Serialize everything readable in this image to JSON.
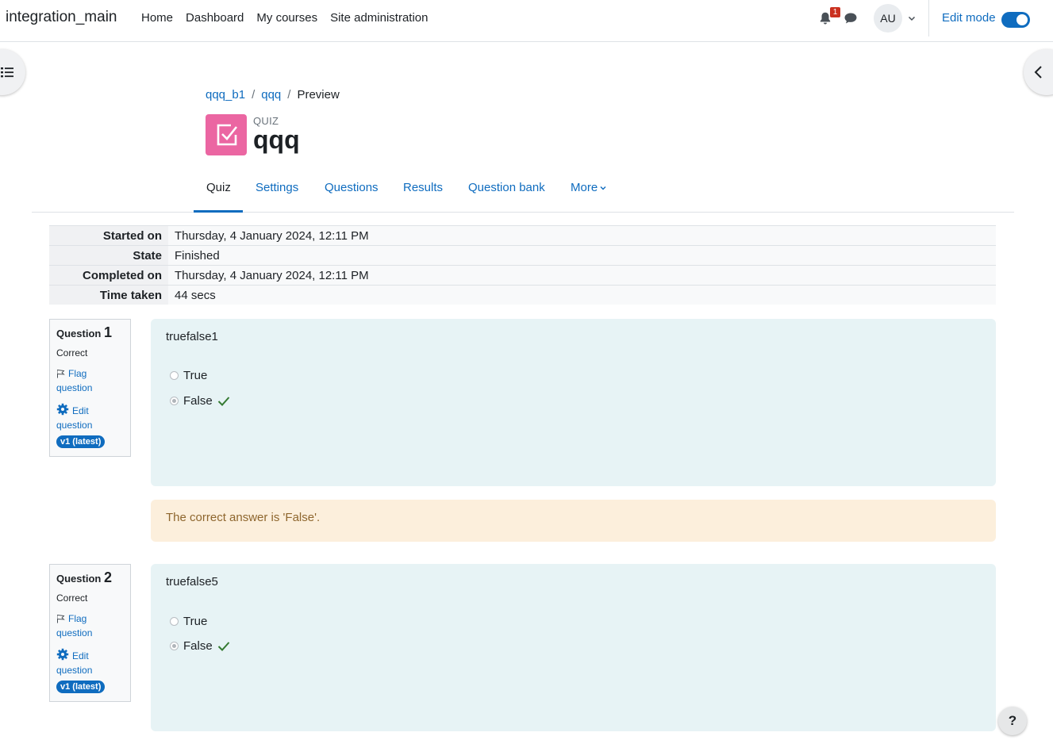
{
  "navbar": {
    "site_name": "integration_main",
    "links": [
      "Home",
      "Dashboard",
      "My courses",
      "Site administration"
    ],
    "notification_count": "1",
    "user_initials": "AU",
    "edit_mode_label": "Edit mode",
    "edit_mode_on": true
  },
  "breadcrumb": {
    "items": [
      "qqq_b1",
      "qqq"
    ],
    "current": "Preview",
    "separator": "/"
  },
  "header": {
    "kicker": "QUIZ",
    "title": "qqq",
    "icon_color": "#eb66a2"
  },
  "tabs": {
    "items": [
      "Quiz",
      "Settings",
      "Questions",
      "Results",
      "Question bank",
      "More"
    ],
    "active": "Quiz"
  },
  "summary": {
    "rows": [
      {
        "label": "Started on",
        "value": "Thursday, 4 January 2024, 12:11 PM"
      },
      {
        "label": "State",
        "value": "Finished"
      },
      {
        "label": "Completed on",
        "value": "Thursday, 4 January 2024, 12:11 PM"
      },
      {
        "label": "Time taken",
        "value": "44 secs"
      }
    ]
  },
  "questions": [
    {
      "label": "Question",
      "number": "1",
      "state": "Correct",
      "flag_label": "Flag question",
      "edit_label": "Edit question",
      "version_badge": "v1 (latest)",
      "text": "truefalse1",
      "options": [
        "True",
        "False"
      ],
      "selected": "False",
      "feedback": "The correct answer is 'False'."
    },
    {
      "label": "Question",
      "number": "2",
      "state": "Correct",
      "flag_label": "Flag question",
      "edit_label": "Edit question",
      "version_badge": "v1 (latest)",
      "text": "truefalse5",
      "options": [
        "True",
        "False"
      ],
      "selected": "False"
    }
  ],
  "help_button": "?",
  "colors": {
    "accent": "#0f6cbf",
    "correct": "#357a32",
    "feedback_bg": "#fcefdc",
    "question_bg": "#e7f3f5"
  }
}
